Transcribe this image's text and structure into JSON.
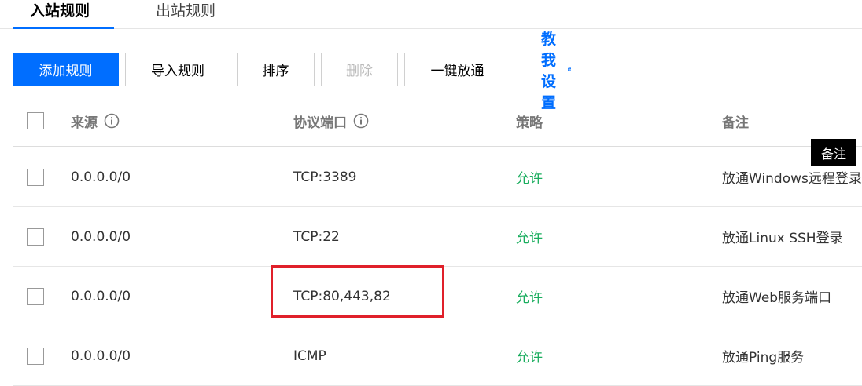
{
  "tabs": {
    "inbound": "入站规则",
    "outbound": "出站规则"
  },
  "toolbar": {
    "add": "添加规则",
    "import": "导入规则",
    "sort": "排序",
    "delete": "删除",
    "open_all": "一键放通",
    "help": "教我设置"
  },
  "table": {
    "headers": {
      "source": "来源",
      "protocol": "协议端口",
      "policy": "策略",
      "note": "备注"
    },
    "rows": [
      {
        "source": "0.0.0.0/0",
        "protocol": "TCP:3389",
        "policy": "允许",
        "note": "放通Windows远程登录"
      },
      {
        "source": "0.0.0.0/0",
        "protocol": "TCP:22",
        "policy": "允许",
        "note": "放通Linux SSH登录"
      },
      {
        "source": "0.0.0.0/0",
        "protocol": "TCP:80,443,82",
        "policy": "允许",
        "note": "放通Web服务端口"
      },
      {
        "source": "0.0.0.0/0",
        "protocol": "ICMP",
        "policy": "允许",
        "note": "放通Ping服务"
      }
    ]
  },
  "tooltip": "备注",
  "colors": {
    "accent": "#006eff",
    "allow": "#1aad5e",
    "highlight": "#e0202a"
  },
  "icons": {
    "info": "info-circle-icon",
    "external": "external-link-icon"
  }
}
